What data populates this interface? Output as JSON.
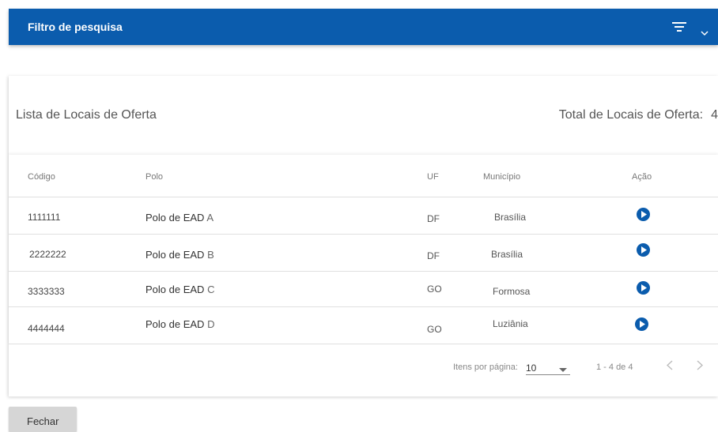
{
  "filter": {
    "title": "Filtro de pesquisa",
    "icon": "filter-icon",
    "toggle_icon": "chevron-down-icon"
  },
  "list": {
    "title": "Lista de Locais de Oferta",
    "total_label": "Total de Locais de Oferta:",
    "total_value": "4"
  },
  "table": {
    "headers": {
      "code": "Código",
      "polo": "Polo",
      "uf": "UF",
      "municipio": "Município",
      "acao": "Ação"
    },
    "rows": [
      {
        "code": "1111111",
        "polo": "Polo de EAD",
        "polo_suffix": "A",
        "uf": "DF",
        "municipio": "Brasília"
      },
      {
        "code": "2222222",
        "polo": "Polo de EAD",
        "polo_suffix": "B",
        "uf": "DF",
        "municipio": "Brasília"
      },
      {
        "code": "3333333",
        "polo": "Polo de EAD",
        "polo_suffix": "C",
        "uf": "GO",
        "municipio": "Formosa"
      },
      {
        "code": "4444444",
        "polo": "Polo de EAD",
        "polo_suffix": "D",
        "uf": "GO",
        "municipio": "Luziânia"
      }
    ]
  },
  "paginator": {
    "label": "Itens por página:",
    "page_size": "10",
    "range": "1 - 4 de 4"
  },
  "footer": {
    "close_label": "Fechar"
  },
  "colors": {
    "primary": "#0b5cad"
  }
}
